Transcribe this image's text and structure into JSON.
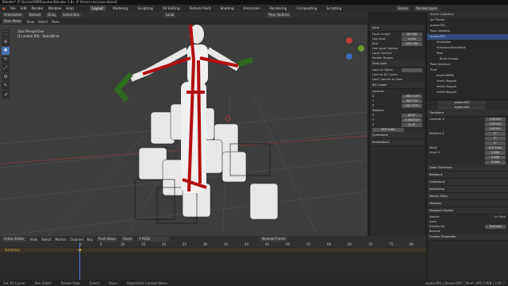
{
  "title_bar": "Blender* [F:\\Scrolls\\MMD\\avatar\\Blender 2.8+ \\P throne real pose.blend]",
  "menu": [
    "File",
    "Edit",
    "Render",
    "Window",
    "Help"
  ],
  "workspaces": [
    "Layout",
    "Modeling",
    "Sculpting",
    "UV Editing",
    "Texture Paint",
    "Shading",
    "Animation",
    "Rendering",
    "Compositing",
    "Scripting"
  ],
  "active_workspace": "Layout",
  "scene": "Scene",
  "view_layer": "RenderLayer",
  "viewport_header": {
    "mode": "Orientation",
    "default": "Default",
    "drag": "Drag",
    "select": "Select Box",
    "local": "Local",
    "options": "Pose Options"
  },
  "viewport_header2": {
    "mode": "Pose Mode",
    "view": "View",
    "select": "Select",
    "pose": "Pose"
  },
  "viewport_label": "User Perspective",
  "viewport_object": "(1) avatar.RIG : RetroWrist",
  "npanel": {
    "view_title": "View",
    "focal_label": "Focal Length",
    "focal": "50.000",
    "clip_start_label": "Clip Start",
    "clip_start": "0.000",
    "clip_end_label": "End",
    "clip_end": "1000.000",
    "local_camera": "Use Local Camera",
    "local_cam_label": "Local Camera",
    "render_region": "Render Region",
    "view_lock": "View Lock",
    "lock_object": "Lock to Object",
    "lock_3d": "Lock to 3D Cursor",
    "lock_camera": "Lock Camera to View",
    "cursor": "3D Cursor",
    "location": "Location",
    "x_label": "X",
    "y_label": "Y",
    "z_label": "Z",
    "loc_x": "-285.7157",
    "loc_y": "-88.2141",
    "loc_z": "162.6759",
    "rotation": "Rotation",
    "rot_x": "68.8°",
    "rot_y": "-0.000016°",
    "rot_z": "24.8°",
    "rot_mode": "XYZ Euler",
    "collections": "Collections",
    "annotations": "Annotations"
  },
  "outliner": [
    {
      "label": "Scene Collection",
      "sel": false
    },
    {
      "label": "Art Planes",
      "sel": false
    },
    {
      "label": "avatar.RIG",
      "sel": false
    },
    {
      "label": "Pose Skeleton",
      "sel": false
    },
    {
      "label": "avatar.RIG",
      "sel": true
    },
    {
      "label": "Animation",
      "sel": false
    },
    {
      "label": "Armature.RetroWrist",
      "sel": false
    },
    {
      "label": "Pose",
      "sel": false
    },
    {
      "label": "Bone Groups",
      "sel": false
    },
    {
      "label": "Pose Skeleton",
      "sel": false
    },
    {
      "label": "Prod",
      "sel": false
    },
    {
      "label": "board.WERV",
      "sel": false
    },
    {
      "label": "reel01.Bogroll",
      "sel": false
    },
    {
      "label": "reel02.Bogroll",
      "sel": false
    },
    {
      "label": "reel03.Bogroll",
      "sel": false
    }
  ],
  "props": {
    "object": "avatar.RIG",
    "data": "avatar.RIG",
    "transform": "Transform",
    "loc_label": "Location X",
    "loc_x": "0.00009",
    "loc_y": "0.00000",
    "loc_z": "0.00001",
    "rot_label": "Rotation X",
    "rot_x": "0°",
    "rot_y": "0°",
    "rot_z": "0°",
    "mode_label": "Mode",
    "mode": "XYZ Euler",
    "scale_label": "Scale X",
    "scale_x": "0.868",
    "scale_y": "0.868",
    "scale_z": "0.868",
    "delta": "Delta Transform",
    "relations": "Relations",
    "collections": "Collections",
    "instancing": "Instancing",
    "motion": "Motion Paths",
    "visibility": "Visibility",
    "viewport_display": "Viewport Display",
    "names": "Names",
    "axes": "Axes",
    "in_front": "In Front",
    "display_as": "Display As",
    "textured": "Textured",
    "bounds": "Bounds",
    "custom": "Custom Properties"
  },
  "timeline_header": {
    "editor": "Action Editor",
    "view": "View",
    "select": "Select",
    "marker": "Marker",
    "channel": "Channel",
    "key": "Key",
    "action": "T-POSE",
    "push_down": "Push Down",
    "stash": "Stash",
    "nearest": "Nearest Frame"
  },
  "timeline_summary": "Summary",
  "ticks": [
    "0",
    "5",
    "10",
    "15",
    "20",
    "25",
    "30",
    "35",
    "40",
    "45",
    "50",
    "55",
    "60",
    "65",
    "70",
    "75",
    "80",
    "85"
  ],
  "status": [
    "Set 3D Cursor",
    "Box Select",
    "Rotate View",
    "Select",
    "Move",
    "Dopesheet Context Menu",
    "avatar.RIG | Bones:0/67 | Mem: 495.4 MiB | 2.82.7"
  ]
}
